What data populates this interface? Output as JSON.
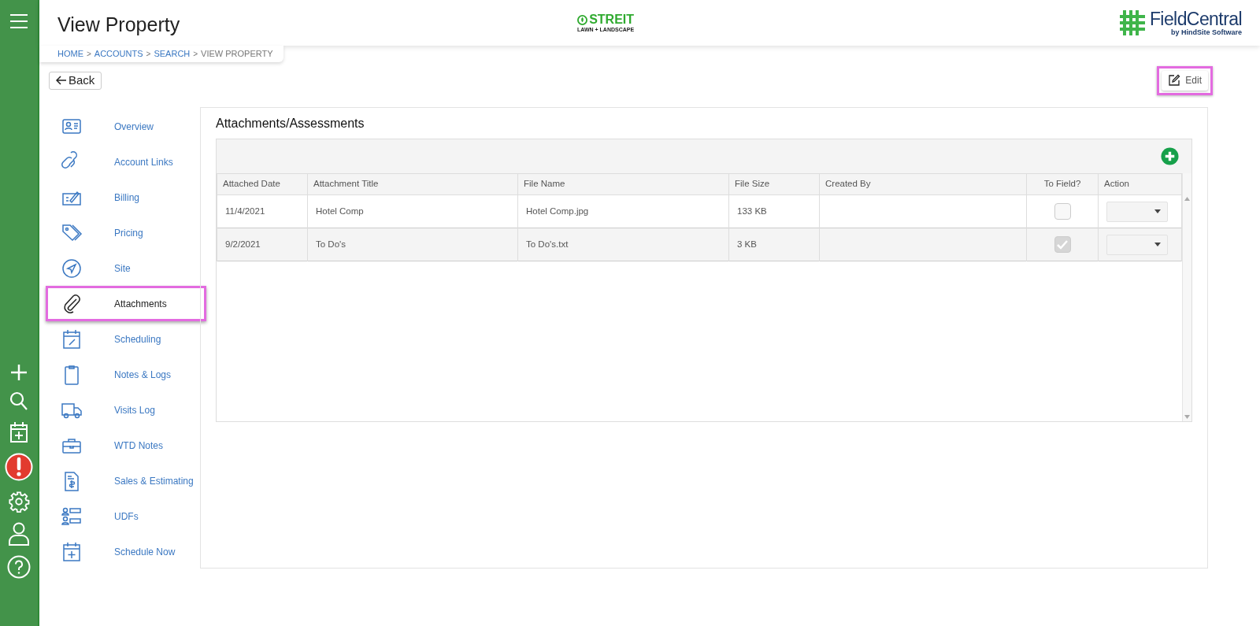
{
  "header": {
    "title": "View Property",
    "company_logo": {
      "name": "STREIT",
      "tagline": "LAWN + LANDSCAPE"
    },
    "product_logo": {
      "name": "FieldCentral",
      "tagline": "by HindSite Software"
    }
  },
  "breadcrumb": {
    "separator": ">",
    "items": [
      {
        "label": "HOME",
        "current": false
      },
      {
        "label": "ACCOUNTS",
        "current": false
      },
      {
        "label": "SEARCH",
        "current": false
      },
      {
        "label": "VIEW PROPERTY",
        "current": true
      }
    ]
  },
  "back_button": {
    "label": "Back"
  },
  "edit_button": {
    "label": "Edit",
    "highlighted": true
  },
  "nav": [
    {
      "label": "Overview",
      "selected": false,
      "highlighted": false
    },
    {
      "label": "Account Links",
      "selected": false,
      "highlighted": false
    },
    {
      "label": "Billing",
      "selected": false,
      "highlighted": false
    },
    {
      "label": "Pricing",
      "selected": false,
      "highlighted": false
    },
    {
      "label": "Site",
      "selected": false,
      "highlighted": false
    },
    {
      "label": "Attachments",
      "selected": true,
      "highlighted": true
    },
    {
      "label": "Scheduling",
      "selected": false,
      "highlighted": false
    },
    {
      "label": "Notes & Logs",
      "selected": false,
      "highlighted": false
    },
    {
      "label": "Visits Log",
      "selected": false,
      "highlighted": false
    },
    {
      "label": "WTD Notes",
      "selected": false,
      "highlighted": false
    },
    {
      "label": "Sales & Estimating",
      "selected": false,
      "highlighted": false
    },
    {
      "label": "UDFs",
      "selected": false,
      "highlighted": false
    },
    {
      "label": "Schedule Now",
      "selected": false,
      "highlighted": false
    }
  ],
  "panel": {
    "title": "Attachments/Assessments",
    "table": {
      "columns": [
        "Attached Date",
        "Attachment Title",
        "File Name",
        "File Size",
        "Created By",
        "To Field?",
        "Action"
      ],
      "rows": [
        {
          "attached_date": "11/4/2021",
          "attachment_title": "Hotel Comp",
          "file_name": "Hotel Comp.jpg",
          "file_size": "133 KB",
          "to_field": {
            "checked": false,
            "disabled": false
          }
        },
        {
          "attached_date": "9/2/2021",
          "attachment_title": "To Do's",
          "file_name": "To Do's.txt",
          "file_size": "3 KB",
          "to_field": {
            "checked": true,
            "disabled": true
          }
        }
      ]
    }
  }
}
